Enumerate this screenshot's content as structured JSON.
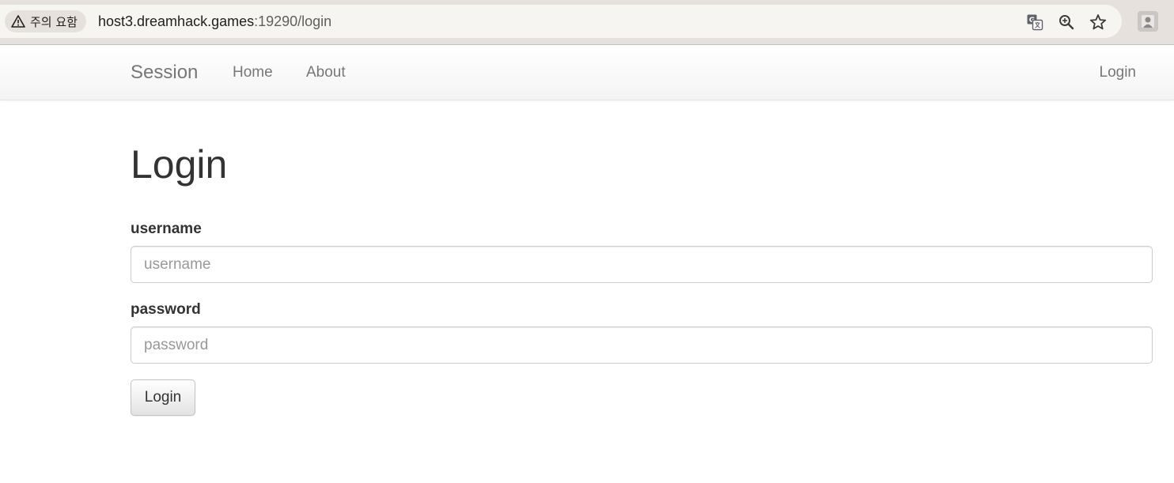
{
  "browser": {
    "security_chip": {
      "icon": "warning-triangle-icon",
      "text": "주의 요함"
    },
    "url": {
      "host": "host3.dreamhack.games",
      "port_path": ":19290/login"
    },
    "icons": [
      "translate-icon",
      "zoom-icon",
      "bookmark-star-icon",
      "profile-avatar-icon"
    ]
  },
  "navbar": {
    "brand": "Session",
    "links": [
      {
        "label": "Home"
      },
      {
        "label": "About"
      }
    ],
    "right_link": "Login"
  },
  "main": {
    "title": "Login",
    "username": {
      "label": "username",
      "placeholder": "username",
      "value": ""
    },
    "password": {
      "label": "password",
      "placeholder": "password",
      "value": ""
    },
    "submit_label": "Login"
  }
}
